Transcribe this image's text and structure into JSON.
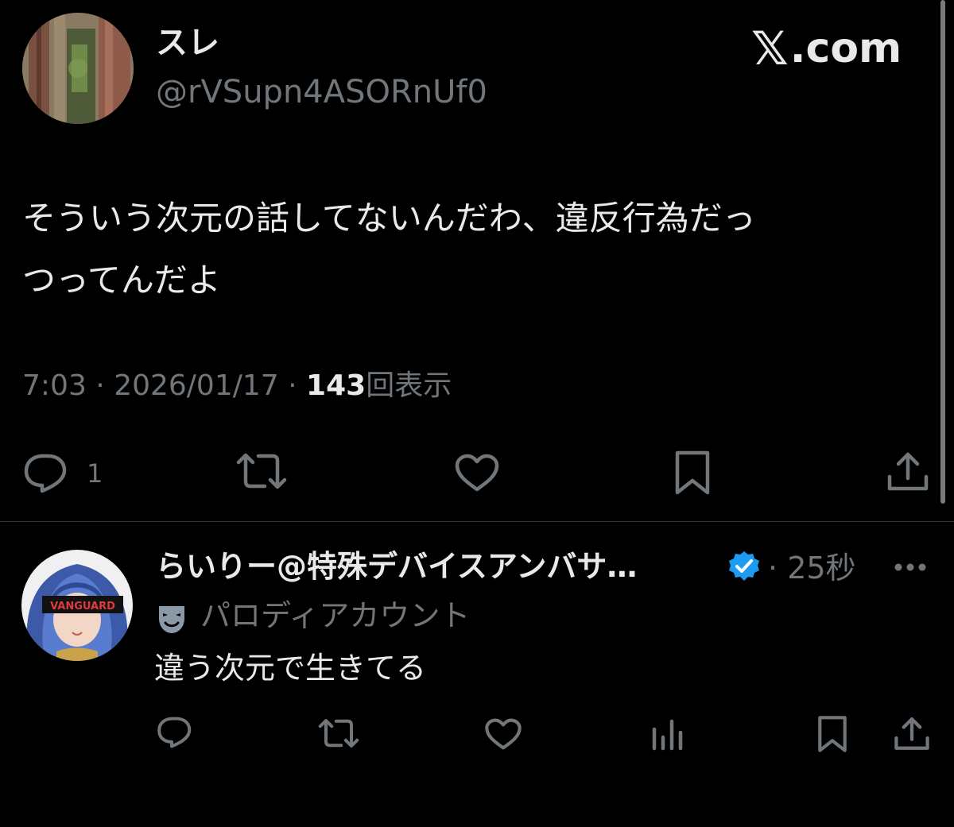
{
  "main_tweet": {
    "display_name": "スレ",
    "handle": "@rVSupn4ASORnUf0",
    "text": "そういう次元の話してないんだわ、違反行為だっ\nつってんだよ",
    "time": "7:03",
    "date": "2026/01/17",
    "views_count": "143",
    "views_label": "回表示",
    "reply_count": "1",
    "avatar_icon": "forest-tree-avatar"
  },
  "brand": {
    "name": ".com",
    "icon": "x-logo-icon"
  },
  "reply": {
    "display_name": "らいりー@特殊デバイスアンバサ…",
    "verified_icon": "verified-badge-icon",
    "time": "25秒",
    "label": "パロディアカウント",
    "label_icon": "theater-mask-icon",
    "text": "違う次元で生きてる",
    "avatar_text": "VANGUARD"
  },
  "colors": {
    "background": "#000000",
    "text_primary": "#e7e9ea",
    "text_secondary": "#71767b",
    "divider": "#2f3336",
    "verified_blue": "#1d9bf0"
  }
}
